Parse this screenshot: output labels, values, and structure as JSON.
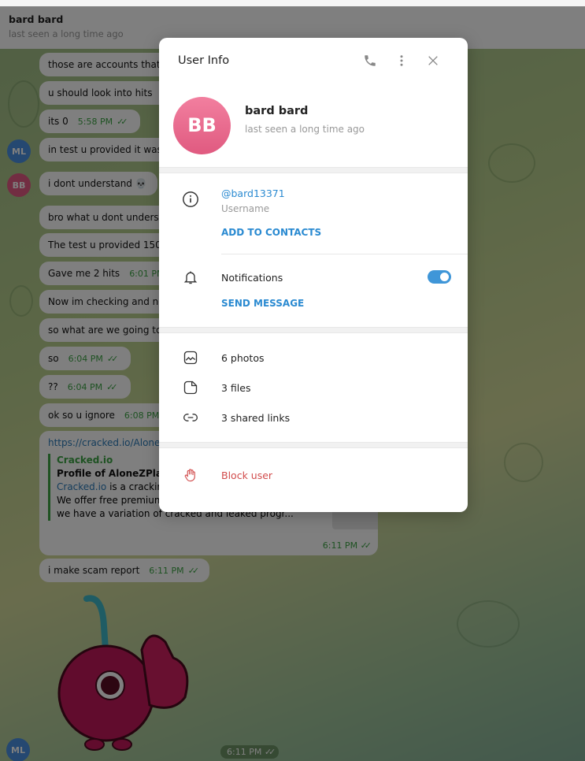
{
  "chat_header": {
    "name": "bard bard",
    "status": "last seen a long time ago"
  },
  "messages": [
    {
      "text": "those are accounts that",
      "time": "",
      "ticks": ""
    },
    {
      "text": "u should look into hits",
      "time": "",
      "ticks": ""
    },
    {
      "text": "its 0",
      "time": "5:58 PM",
      "ticks": "✓✓"
    },
    {
      "text": "in test u provided it was",
      "time": "",
      "ticks": "",
      "avatar": "ML"
    },
    {
      "text": "i dont understand 💀",
      "time": "",
      "ticks": "",
      "avatar": "BB"
    },
    {
      "text": "bro what u dont unders",
      "time": "",
      "ticks": ""
    },
    {
      "text": "The test u provided 150",
      "time": "",
      "ticks": ""
    },
    {
      "text": "Gave me 2 hits",
      "time": "6:01 PM",
      "ticks": ""
    },
    {
      "text": "Now im checking and no",
      "time": "",
      "ticks": ""
    },
    {
      "text": "so what are we going to",
      "time": "",
      "ticks": ""
    },
    {
      "text": "so",
      "time": "6:04 PM",
      "ticks": "✓✓"
    },
    {
      "text": "??",
      "time": "6:04 PM",
      "ticks": "✓✓"
    },
    {
      "text": "ok so u ignore",
      "time": "6:08 PM",
      "ticks": ""
    }
  ],
  "link_message": {
    "url": "https://cracked.io/AloneZ",
    "site": "Cracked.io",
    "title": "Profile of AloneZPlay",
    "desc_link": "Cracked.io",
    "desc_1": " is a cracking",
    "desc_2": "We offer free premium",
    "desc_3": "we have a variation of cracked and leaked progr...",
    "time": "6:11 PM",
    "ticks": "✓✓"
  },
  "last_message": {
    "text": "i make scam report",
    "time": "6:11 PM",
    "ticks": "✓✓"
  },
  "sticker": {
    "time": "6:11 PM",
    "ticks": "✓✓",
    "avatar": "ML"
  },
  "modal": {
    "title": "User Info",
    "avatar_initials": "BB",
    "name": "bard bard",
    "status": "last seen a long time ago",
    "username": "@bard13371",
    "username_label": "Username",
    "add_contacts": "ADD TO CONTACTS",
    "notifications_label": "Notifications",
    "notifications_on": true,
    "send_message": "SEND MESSAGE",
    "media": [
      {
        "icon": "photo-icon",
        "label": "6 photos"
      },
      {
        "icon": "file-icon",
        "label": "3 files"
      },
      {
        "icon": "link-icon",
        "label": "3 shared links"
      }
    ],
    "block_user": "Block user"
  },
  "colors": {
    "accent": "#2a8ad1",
    "danger": "#d14b4b",
    "time_green": "#3ca444",
    "avatar_bb": "#e45a84",
    "avatar_ml": "#4a90e2"
  }
}
